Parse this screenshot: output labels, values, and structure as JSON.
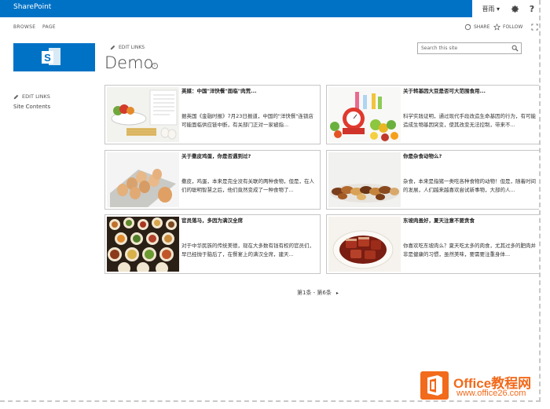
{
  "suitebar": {
    "brand": "SharePoint",
    "user": "晋雨",
    "user_caret": "▾",
    "settings_icon": "gear-icon",
    "help": "?"
  },
  "ribbon": {
    "tabs": [
      "BROWSE",
      "PAGE"
    ],
    "share": "SHARE",
    "follow": "FOLLOW"
  },
  "site": {
    "edit_links": "EDIT LINKS",
    "title": "Demo",
    "info": "i"
  },
  "search": {
    "placeholder": "Search this site"
  },
  "leftnav": {
    "edit_links": "EDIT LINKS",
    "site_contents": "Site Contents"
  },
  "cards": [
    {
      "title": "英媒：中国\"洋快餐\"面临\"肉荒...",
      "desc": "据英国《金融时报》7月23日报道，中国的\"洋快餐\"连锁店可能面临供应链中断，有关部门正对一家被指...",
      "thumb": "breakfast"
    },
    {
      "title": "关于转基因大豆是否可大范围食用...",
      "desc": "科学实践证明，通过现代手段改造生命基因的行为，有可能造成生物基因突变，使其改变无法控制，带来不...",
      "thumb": "scale"
    },
    {
      "title": "关于撒皮鸡蛋，你是否遇到过?",
      "desc": "撒皮，鸡蛋，本来是完全没有关联的两种食物，但是，在人们的聪明智慧之后，他们竟然变成了一种食物了...",
      "thumb": "eggs"
    },
    {
      "title": "你是杂食动物么?",
      "desc": "杂食，本来是指猪一类吃各种食物的动物！但是，随着时间的发展，人们越来越喜欢尝试新事物，大部的人...",
      "thumb": "nuts"
    },
    {
      "title": "官员落马，多因为满汉全席",
      "desc": "对于中华民族的传统美德，现在大多数有钱有权的官员们，早已经抛于脑后了，在餐宴上的满汉全席，建天...",
      "thumb": "feast"
    },
    {
      "title": "东坡肉虽好，夏天注意不要贪食",
      "desc": "你喜欢吃东坡肉么？夏天吃太多的肉食，尤其过多的肥肉并非是健康的习惯，虽然美味，要需要注重身体...",
      "thumb": "pork"
    }
  ],
  "pager": {
    "label": "第1条 - 第6条",
    "next": "▸"
  },
  "watermark": {
    "name": "Office教程网",
    "url": "www.office26.com"
  },
  "colors": {
    "brand": "#0072c6",
    "watermark": "#f26a1b"
  }
}
